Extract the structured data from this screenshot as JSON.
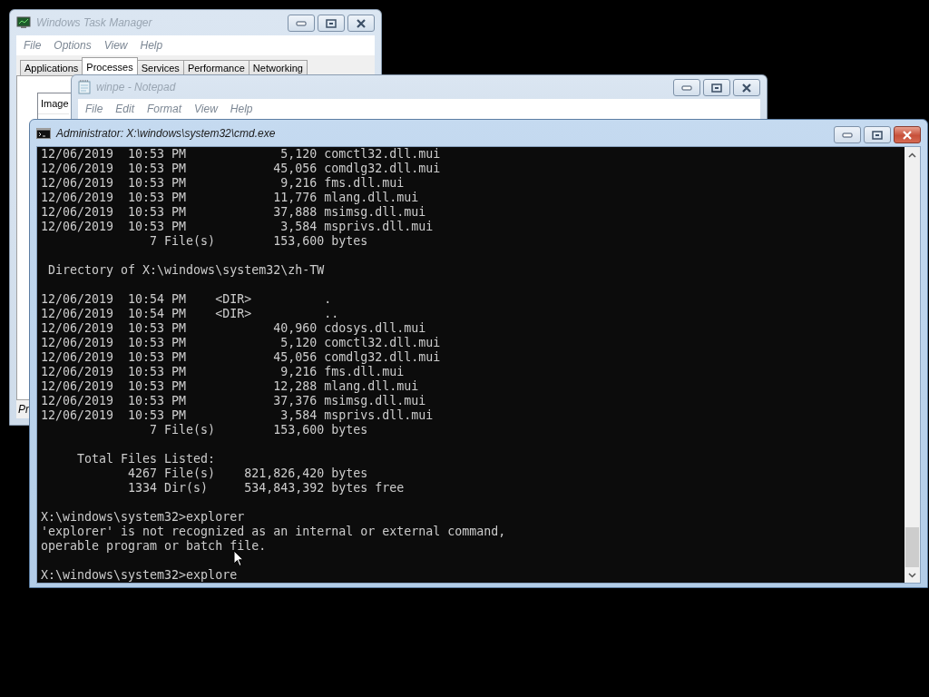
{
  "task_manager": {
    "title": "Windows Task Manager",
    "active": false,
    "menu": [
      "File",
      "Options",
      "View",
      "Help"
    ],
    "tabs": [
      {
        "label": "Applications",
        "selected": false
      },
      {
        "label": "Processes",
        "selected": true
      },
      {
        "label": "Services",
        "selected": false
      },
      {
        "label": "Performance",
        "selected": false
      },
      {
        "label": "Networking",
        "selected": false
      }
    ],
    "column_1": "Image",
    "status_bar": "Pr"
  },
  "notepad": {
    "title": "winpe - Notepad",
    "active": false,
    "menu": [
      "File",
      "Edit",
      "Format",
      "View",
      "Help"
    ]
  },
  "cmd": {
    "title": "Administrator: X:\\windows\\system32\\cmd.exe",
    "active": true,
    "blocks": [
      [
        "12/06/2019  10:53 PM             5,120 comctl32.dll.mui",
        "12/06/2019  10:53 PM            45,056 comdlg32.dll.mui",
        "12/06/2019  10:53 PM             9,216 fms.dll.mui",
        "12/06/2019  10:53 PM            11,776 mlang.dll.mui",
        "12/06/2019  10:53 PM            37,888 msimsg.dll.mui",
        "12/06/2019  10:53 PM             3,584 msprivs.dll.mui",
        "               7 File(s)        153,600 bytes"
      ],
      [
        " Directory of X:\\windows\\system32\\zh-TW"
      ],
      [
        "12/06/2019  10:54 PM    <DIR>          .",
        "12/06/2019  10:54 PM    <DIR>          ..",
        "12/06/2019  10:53 PM            40,960 cdosys.dll.mui",
        "12/06/2019  10:53 PM             5,120 comctl32.dll.mui",
        "12/06/2019  10:53 PM            45,056 comdlg32.dll.mui",
        "12/06/2019  10:53 PM             9,216 fms.dll.mui",
        "12/06/2019  10:53 PM            12,288 mlang.dll.mui",
        "12/06/2019  10:53 PM            37,376 msimsg.dll.mui",
        "12/06/2019  10:53 PM             3,584 msprivs.dll.mui",
        "               7 File(s)        153,600 bytes"
      ],
      [
        "     Total Files Listed:",
        "            4267 File(s)    821,826,420 bytes",
        "            1334 Dir(s)     534,843,392 bytes free"
      ],
      [
        "X:\\windows\\system32>explorer",
        "'explorer' is not recognized as an internal or external command,",
        "operable program or batch file."
      ],
      [
        "X:\\windows\\system32>explore"
      ]
    ]
  }
}
